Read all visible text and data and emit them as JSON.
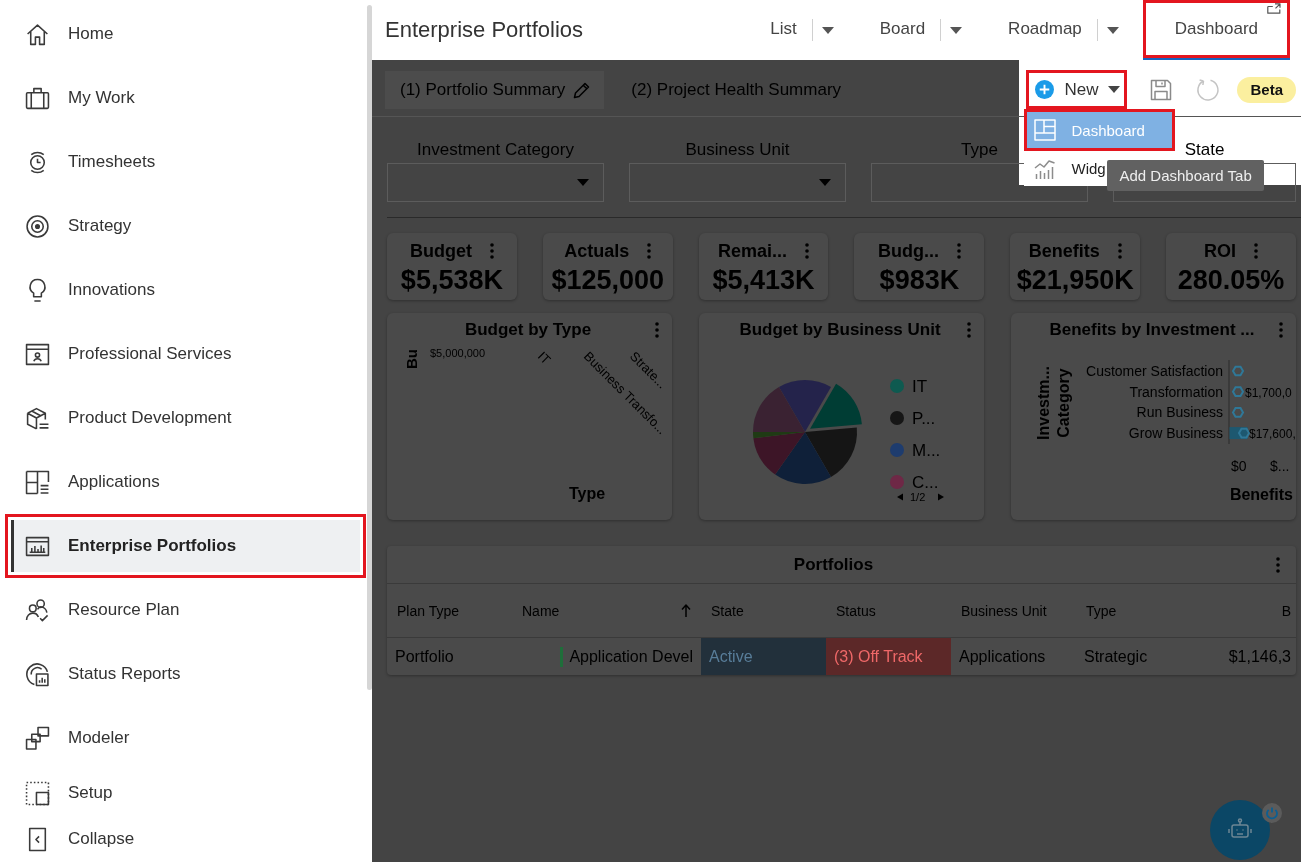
{
  "sidebar": {
    "items": [
      {
        "label": "Home",
        "selected": false,
        "highlighted": false
      },
      {
        "label": "My Work",
        "selected": false,
        "highlighted": false
      },
      {
        "label": "Timesheets",
        "selected": false,
        "highlighted": false
      },
      {
        "label": "Strategy",
        "selected": false,
        "highlighted": false
      },
      {
        "label": "Innovations",
        "selected": false,
        "highlighted": false
      },
      {
        "label": "Professional Services",
        "selected": false,
        "highlighted": false
      },
      {
        "label": "Product Development",
        "selected": false,
        "highlighted": false
      },
      {
        "label": "Applications",
        "selected": false,
        "highlighted": false
      },
      {
        "label": "Enterprise Portfolios",
        "selected": true,
        "highlighted": true
      },
      {
        "label": "Resource Plan",
        "selected": false,
        "highlighted": false
      },
      {
        "label": "Status Reports",
        "selected": false,
        "highlighted": false
      },
      {
        "label": "Modeler",
        "selected": false,
        "highlighted": false
      }
    ],
    "footer": [
      {
        "label": "Setup"
      },
      {
        "label": "Collapse"
      }
    ]
  },
  "header": {
    "title": "Enterprise Portfolios",
    "views": [
      {
        "label": "List",
        "dropdown": true,
        "selected": false,
        "highlighted": false
      },
      {
        "label": "Board",
        "dropdown": true,
        "selected": false,
        "highlighted": false
      },
      {
        "label": "Roadmap",
        "dropdown": true,
        "selected": false,
        "highlighted": false
      },
      {
        "label": "Dashboard",
        "dropdown": false,
        "selected": true,
        "highlighted": true
      }
    ]
  },
  "dashboard": {
    "tabs": [
      {
        "label": "(1) Portfolio Summary",
        "selected": true
      },
      {
        "label": "(2) Project Health Summary",
        "selected": false
      }
    ],
    "toolbar": {
      "new_button": {
        "label": "New",
        "highlighted": true
      },
      "badge": "Beta"
    },
    "new_menu": {
      "items": [
        {
          "label": "Dashboard",
          "selected": true,
          "highlighted": true
        },
        {
          "label": "Widg",
          "selected": false,
          "highlighted": false
        }
      ],
      "tooltip": "Add Dashboard Tab"
    },
    "filters": [
      {
        "label": "Investment Category",
        "caret": true
      },
      {
        "label": "Business Unit",
        "caret": true
      },
      {
        "label": "Type"
      },
      {
        "label": "State",
        "caret": false
      }
    ],
    "kpis": [
      {
        "title": "Budget",
        "value": "$5,538K"
      },
      {
        "title": "Actuals",
        "value": "$125,000"
      },
      {
        "title": "Remai...",
        "value": "$5,413K"
      },
      {
        "title": "Budg...",
        "value": "$983K"
      },
      {
        "title": "Benefits",
        "value": "$21,950K"
      },
      {
        "title": "ROI",
        "value": "280.05%"
      }
    ],
    "charts": [
      {
        "kind": "column",
        "title": "Budget by Type",
        "y_title": "Bu",
        "y_tick": "$5,000,000",
        "categories": [
          "IT",
          "Business Transfo...",
          "Strate..."
        ],
        "x_title": "Type"
      },
      {
        "kind": "pie",
        "title": "Budget by Business Unit",
        "legend": [
          {
            "label": "IT",
            "color": "#0e5a50"
          },
          {
            "label": "P...",
            "color": "#161616"
          },
          {
            "label": "M...",
            "color": "#1e3c6e"
          },
          {
            "label": "C...",
            "color": "#6e2846"
          }
        ],
        "pager": "1/2"
      },
      {
        "kind": "bar",
        "title": "Benefits by Investment ...",
        "y_title": [
          "Investm...",
          "Category"
        ],
        "categories": [
          {
            "label": "Customer Satisfaction"
          },
          {
            "label": "Transformation",
            "value_label": "$1,700,0"
          },
          {
            "label": "Run Business"
          },
          {
            "label": "Grow Business",
            "value_label": "$17,600,"
          }
        ],
        "x_ticks": [
          "$0",
          "$..."
        ],
        "x_title": "Benefits"
      }
    ],
    "table": {
      "title": "Portfolios",
      "columns": [
        {
          "label": "Plan Type",
          "sorted": false
        },
        {
          "label": "Name",
          "sorted": true
        },
        {
          "label": "State",
          "sorted": false
        },
        {
          "label": "Status",
          "sorted": false
        },
        {
          "label": "Business Unit",
          "sorted": false
        },
        {
          "label": "Type",
          "sorted": false
        },
        {
          "label": "B",
          "sorted": false
        }
      ],
      "rows": [
        {
          "cells": [
            {
              "kind": "plain",
              "text": "Portfolio"
            },
            {
              "kind": "marked",
              "text": "Application Devel",
              "color": "#1f6e3a"
            },
            {
              "kind": "chip",
              "text": "Active",
              "color": "#22303b"
            },
            {
              "kind": "chip",
              "text": "(3) Off Track",
              "color": "#5c2828"
            },
            {
              "kind": "plain",
              "text": "Applications"
            },
            {
              "kind": "plain",
              "text": "Strategic"
            },
            {
              "kind": "plain",
              "text": "$1,146,3"
            }
          ]
        }
      ]
    }
  }
}
